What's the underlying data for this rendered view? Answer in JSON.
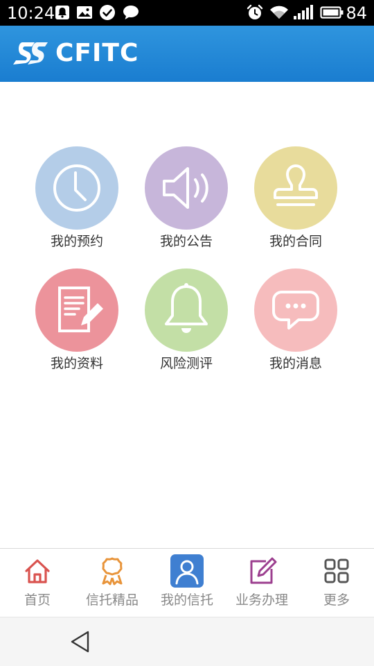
{
  "status_bar": {
    "time": "10:24",
    "battery": "84",
    "icons": [
      "notification-icon",
      "image-icon",
      "check-icon",
      "chat-icon",
      "alarm-icon",
      "wifi-icon",
      "signal-icon",
      "battery-icon"
    ]
  },
  "header": {
    "brand": "CFITC",
    "logo_icon": "cfitc-logo-icon",
    "background": "#1a7dd0"
  },
  "grid": {
    "items": [
      {
        "label": "我的预约",
        "icon": "clock-icon",
        "color": "#b4cde8"
      },
      {
        "label": "我的公告",
        "icon": "speaker-icon",
        "color": "#c7b6da"
      },
      {
        "label": "我的合同",
        "icon": "stamp-icon",
        "color": "#e8dc9c"
      },
      {
        "label": "我的资料",
        "icon": "document-edit-icon",
        "color": "#ec939b"
      },
      {
        "label": "风险测评",
        "icon": "bell-icon",
        "color": "#c3dfa6"
      },
      {
        "label": "我的消息",
        "icon": "message-bubble-icon",
        "color": "#f6bcbd"
      }
    ]
  },
  "bottom_nav": {
    "items": [
      {
        "label": "首页",
        "icon": "home-icon",
        "color": "#d9534f"
      },
      {
        "label": "信托精品",
        "icon": "award-icon",
        "color": "#e8943a"
      },
      {
        "label": "我的信托",
        "icon": "user-icon",
        "color": "#3f7fd1",
        "active": true
      },
      {
        "label": "业务办理",
        "icon": "edit-icon",
        "color": "#9c3f8f"
      },
      {
        "label": "更多",
        "icon": "grid-icon",
        "color": "#555555"
      }
    ]
  },
  "system_nav": {
    "back_icon": "back-triangle-icon"
  }
}
